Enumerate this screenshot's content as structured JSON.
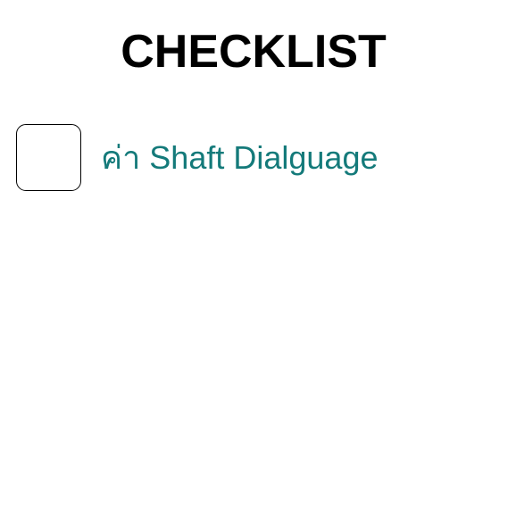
{
  "page": {
    "title": "CHECKLIST"
  },
  "checklist": {
    "items": [
      {
        "label": "ค่า Shaft Dialguage",
        "checked": false
      }
    ]
  },
  "colors": {
    "item_text": "#147a7a",
    "title_text": "#000000",
    "checkbox_border": "#000000"
  }
}
